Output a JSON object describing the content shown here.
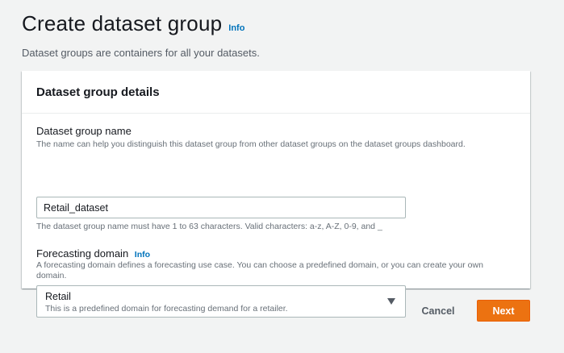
{
  "header": {
    "title": "Create dataset group",
    "info_label": "Info",
    "description": "Dataset groups are containers for all your datasets."
  },
  "panel": {
    "title": "Dataset group details",
    "name_field": {
      "label": "Dataset group name",
      "description": "The name can help you distinguish this dataset group from other dataset groups on the dataset groups dashboard.",
      "value": "Retail_dataset",
      "constraint": "The dataset group name must have 1 to 63 characters. Valid characters: a-z, A-Z, 0-9, and _"
    },
    "domain_field": {
      "label": "Forecasting domain",
      "info_label": "Info",
      "description": "A forecasting domain defines a forecasting use case. You can choose a predefined domain, or you can create your own domain.",
      "selected_value": "Retail",
      "selected_description": "This is a predefined domain for forecasting demand for a retailer.",
      "icon": "caret-down-icon"
    }
  },
  "actions": {
    "cancel_label": "Cancel",
    "next_label": "Next"
  },
  "colors": {
    "primary_button": "#ec7211",
    "link": "#0073bb",
    "background": "#f2f3f3"
  }
}
